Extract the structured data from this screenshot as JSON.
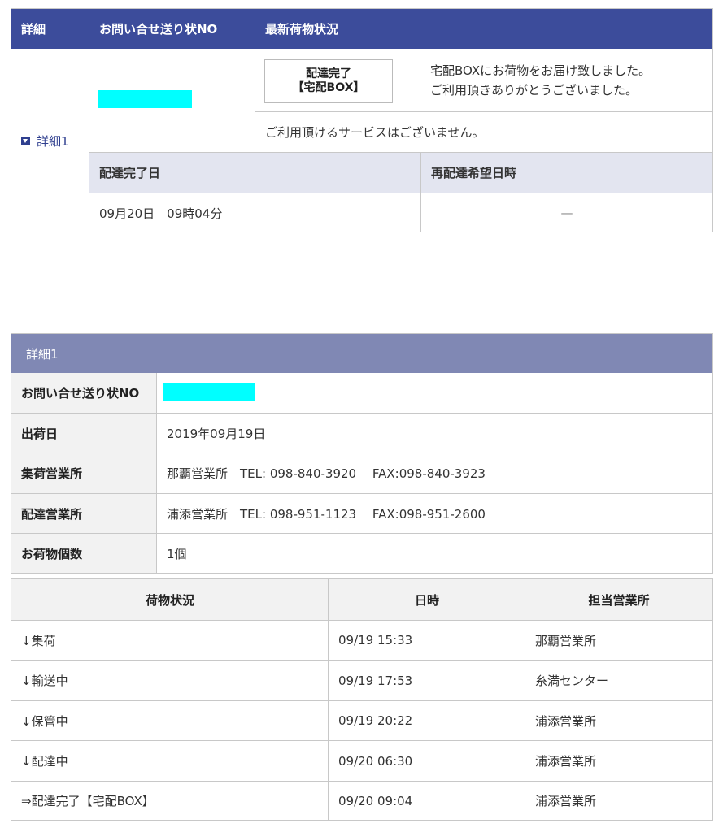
{
  "summary_table": {
    "headers": {
      "detail": "詳細",
      "inquiry_no": "お問い合せ送り状NO",
      "latest_status": "最新荷物状況"
    },
    "detail_link": "詳細1",
    "status_badge": {
      "line1": "配達完了",
      "line2": "【宅配BOX】"
    },
    "status_message": {
      "line1": "宅配BOXにお荷物をお届け致しました。",
      "line2": "ご利用頂きありがとうございました。"
    },
    "service_note": "ご利用頂けるサービスはございません。",
    "delivered_date_header": "配達完了日",
    "redelivery_header": "再配達希望日時",
    "delivered_date_value": "09月20日　09時04分",
    "redelivery_value": "—"
  },
  "detail": {
    "title": "詳細1",
    "rows": [
      {
        "label": "お問い合せ送り状NO",
        "value": ""
      },
      {
        "label": "出荷日",
        "value": "2019年09月19日"
      },
      {
        "label": "集荷営業所",
        "value": "那覇営業所　TEL: 098-840-3920　 FAX:098-840-3923"
      },
      {
        "label": "配達営業所",
        "value": "浦添営業所　TEL: 098-951-1123　 FAX:098-951-2600"
      },
      {
        "label": "お荷物個数",
        "value": "1個"
      }
    ]
  },
  "history": {
    "headers": [
      "荷物状況",
      "日時",
      "担当営業所"
    ],
    "rows": [
      {
        "status": "↓集荷",
        "datetime": "09/19 15:33",
        "office": "那覇営業所"
      },
      {
        "status": "↓輸送中",
        "datetime": "09/19 17:53",
        "office": "糸満センター"
      },
      {
        "status": "↓保管中",
        "datetime": "09/19 20:22",
        "office": "浦添営業所"
      },
      {
        "status": "↓配達中",
        "datetime": "09/20 06:30",
        "office": "浦添営業所"
      },
      {
        "status": "⇒配達完了【宅配BOX】",
        "datetime": "09/20 09:04",
        "office": "浦添営業所"
      }
    ]
  },
  "colors": {
    "header_bg": "#3c4c9b",
    "detail_title_bg": "#8088b4",
    "subhead_bg": "#e3e5f0",
    "redaction": "#00ffff"
  }
}
